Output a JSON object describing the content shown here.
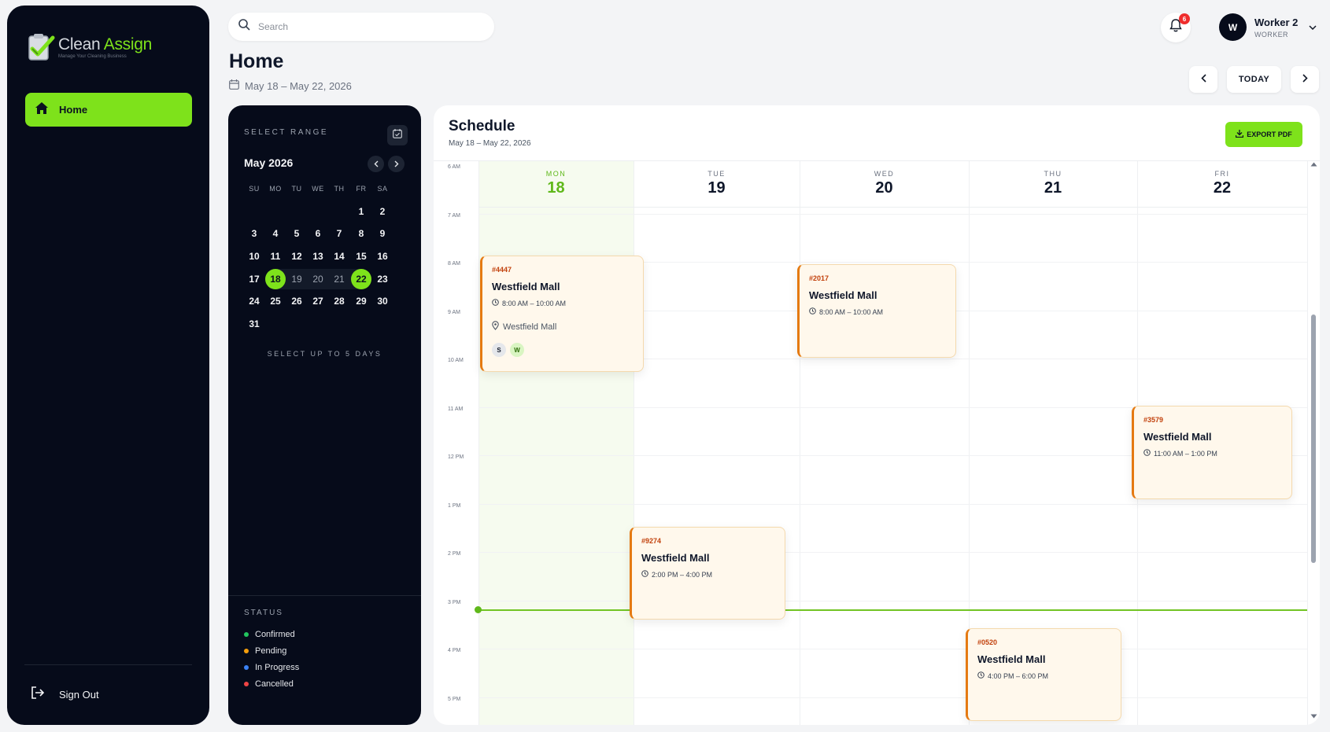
{
  "app": {
    "logo_word1": "Clean",
    "logo_word2": "Assign",
    "logo_tagline": "Manage Your Cleaning Business"
  },
  "sidebar": {
    "home_label": "Home",
    "signout_label": "Sign Out"
  },
  "topbar": {
    "search_placeholder": "Search",
    "page_title": "Home",
    "date_range": "May 18 – May 22, 2026",
    "notification_count": "6",
    "user_initial": "W",
    "user_name": "Worker 2",
    "user_role": "WORKER",
    "today_label": "TODAY"
  },
  "calendar": {
    "select_range_label": "SELECT RANGE",
    "month_label": "May 2026",
    "weekdays": [
      "SU",
      "MO",
      "TU",
      "WE",
      "TH",
      "FR",
      "SA"
    ],
    "days": [
      "1",
      "2",
      "3",
      "4",
      "5",
      "6",
      "7",
      "8",
      "9",
      "10",
      "11",
      "12",
      "13",
      "14",
      "15",
      "16",
      "17",
      "18",
      "19",
      "20",
      "21",
      "22",
      "23",
      "24",
      "25",
      "26",
      "27",
      "28",
      "29",
      "30",
      "31"
    ],
    "selected_start": 18,
    "selected_end": 22,
    "note": "SELECT UP TO 5 DAYS",
    "status_title": "STATUS",
    "statuses": [
      {
        "label": "Confirmed",
        "color": "#22c55e"
      },
      {
        "label": "Pending",
        "color": "#f59e0b"
      },
      {
        "label": "In Progress",
        "color": "#3b82f6"
      },
      {
        "label": "Cancelled",
        "color": "#ef4444"
      }
    ]
  },
  "schedule": {
    "title": "Schedule",
    "subtitle": "May 18 – May 22, 2026",
    "export_label": "EXPORT PDF",
    "times": [
      "6 AM",
      "7 AM",
      "8 AM",
      "9 AM",
      "10 AM",
      "11 AM",
      "12 PM",
      "1 PM",
      "2 PM",
      "3 PM",
      "4 PM",
      "5 PM"
    ],
    "days": [
      {
        "name": "MON",
        "date": "18"
      },
      {
        "name": "TUE",
        "date": "19"
      },
      {
        "name": "WED",
        "date": "20"
      },
      {
        "name": "THU",
        "date": "21"
      },
      {
        "name": "FRI",
        "date": "22"
      }
    ],
    "events": [
      {
        "id": "#4447",
        "location": "Westfield Mall",
        "time": "8:00 AM – 10:00 AM",
        "place": "Westfield Mall",
        "chips": [
          "S",
          "W"
        ]
      },
      {
        "id": "#2017",
        "location": "Westfield Mall",
        "time": "8:00 AM – 10:00 AM"
      },
      {
        "id": "#3579",
        "location": "Westfield Mall",
        "time": "11:00 AM – 1:00 PM"
      },
      {
        "id": "#9274",
        "location": "Westfield Mall",
        "time": "2:00 PM – 4:00 PM"
      },
      {
        "id": "#0520",
        "location": "Westfield Mall",
        "time": "4:00 PM – 6:00 PM"
      }
    ]
  },
  "colors": {
    "accent": "#7ee21b",
    "dark": "#060b1a",
    "event_border": "#e57a12",
    "event_bg": "#fff8ec"
  }
}
